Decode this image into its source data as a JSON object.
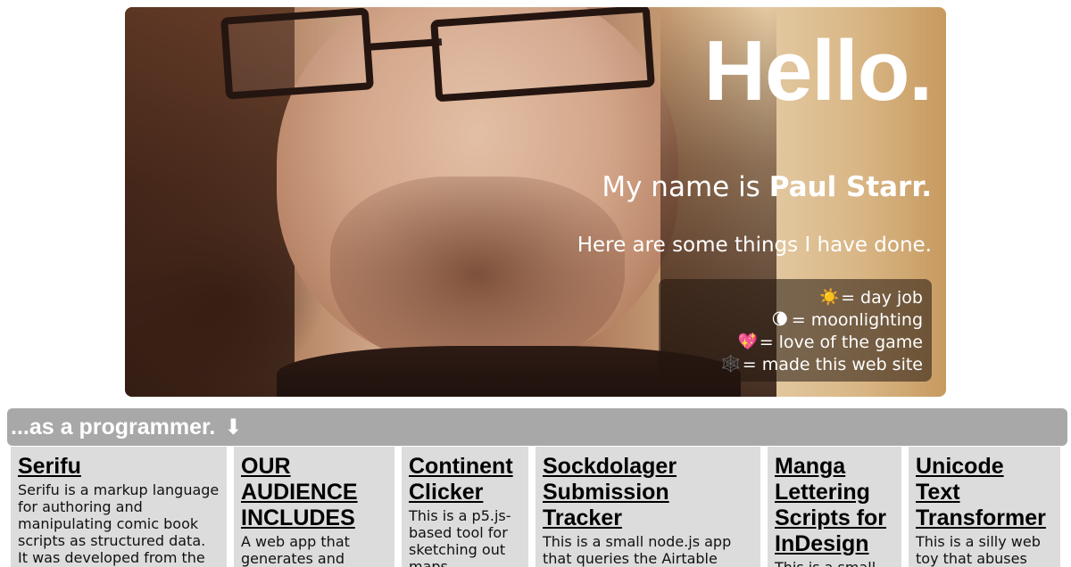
{
  "hero": {
    "title": "Hello.",
    "name_prefix": "My name is ",
    "name": "Paul Starr.",
    "subtitle": "Here are some things I have done."
  },
  "legend": [
    {
      "icon": "sun-icon",
      "glyph": "☀️",
      "label": "= day job"
    },
    {
      "icon": "moon-icon",
      "glyph": "🌘",
      "label": "= moonlighting"
    },
    {
      "icon": "sparkling-heart-icon",
      "glyph": "💖",
      "label": "= love of the game"
    },
    {
      "icon": "spider-web-icon",
      "glyph": "🕸️",
      "label": "= made this web site"
    }
  ],
  "section": {
    "title": "...as a programmer.",
    "arrow": "⬇"
  },
  "projects": [
    {
      "title": "Serifu",
      "description": "Serifu is a markup language for authoring and manipulating comic book scripts as structured data. It was developed from the"
    },
    {
      "title": "OUR AUDIENCE INCLUDES",
      "description": "A web app that generates and"
    },
    {
      "title": "Continent Clicker",
      "description": "This is a p5.js-based tool for sketching out maps"
    },
    {
      "title": "Sockdolager Submission Tracker",
      "description": "This is a small node.js app that queries the Airtable"
    },
    {
      "title": "Manga Lettering Scripts for InDesign",
      "description": "This is a small"
    },
    {
      "title": "Unicode Text Transformer",
      "description": "This is a silly web toy that abuses"
    }
  ],
  "colors": {
    "section_bar": "#a8a8a8",
    "card_bg": "#dcdcdc",
    "hero_text": "#ffffff"
  }
}
